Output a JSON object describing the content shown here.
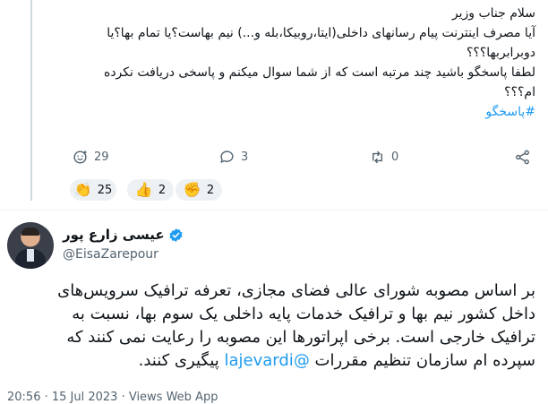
{
  "reply": {
    "lines": [
      "سلام جناب وزیر",
      "آیا مصرف اینترنت پیام رسانهای داخلی(ایتا،روبیکا،بله و...) نیم بهاست؟یا تمام بها؟یا",
      "دوبرابربها؟؟؟",
      "لطفا پاسخگو باشید چند مرتبه است که از شما سوال میکنم و پاسخی دریافت نکرده",
      "ام؟؟؟"
    ],
    "hashtag": "#پاسخگو",
    "stats": {
      "views": "29",
      "replies": "3",
      "retweets": "0"
    },
    "reactions": [
      {
        "emoji": "👏",
        "count": "25"
      },
      {
        "emoji": "👍",
        "count": "2"
      },
      {
        "emoji": "✊",
        "count": "2"
      }
    ]
  },
  "tweet": {
    "author_name": "عیسی زارع پور",
    "handle": "@EisaZarepour",
    "lines": [
      "بر اساس مصوبه شورای عالی فضای مجازی،  تعرفه ترافیک سرویس‌های",
      "داخل کشور  نیم بها و ترافیک خدمات پایه داخلی یک سوم بها، نسبت به",
      "ترافیک خارجی است. برخی اپراتورها این مصوبه را رعایت نمی کنند که"
    ],
    "last_line_before": "سپرده ام سازمان تنظیم مقررات ",
    "mention": "@lajevardi",
    "last_line_after": " پیگیری کنند.",
    "meta": "20:56 · 15 Jul 2023 · Views Web App"
  },
  "colors": {
    "accent": "#1d9bf0",
    "muted": "#536471",
    "text": "#0f1419"
  }
}
